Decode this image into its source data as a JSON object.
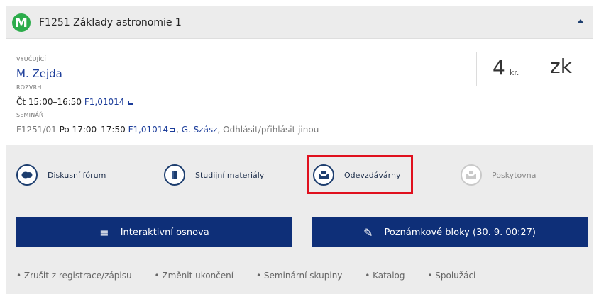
{
  "header": {
    "badge": "M",
    "title": "F1251 Základy astronomie 1"
  },
  "info": {
    "teacher_label": "VYUČUJÍCÍ",
    "teacher": "M. Zejda",
    "schedule_label": "ROZVRH",
    "schedule_time": "Čt 15:00–16:50",
    "schedule_room": "F1,01014",
    "seminar_label": "SEMINÁŘ",
    "seminar_code": "F1251/01",
    "seminar_time": "Po 17:00–17:50",
    "seminar_room": "F1,01014",
    "seminar_teacher": "G. Szász",
    "seminar_action": "Odhlásit/přihlásit jinou",
    "credits": "4",
    "credits_unit": "kr.",
    "completion": "zk"
  },
  "tiles": [
    {
      "label": "Diskusní fórum",
      "icon": "chat-bubbles-icon"
    },
    {
      "label": "Studijní materiály",
      "icon": "folder-icon"
    },
    {
      "label": "Odevzdávárny",
      "icon": "dropbox-icon"
    },
    {
      "label": "Poskytovna",
      "icon": "dropbox-icon"
    }
  ],
  "buttons": {
    "syllabus": "Interaktivní osnova",
    "notes": "Poznámkové bloky (30. 9. 00:27)"
  },
  "footer": [
    "Zrušit z registrace/zápisu",
    "Změnit ukončení",
    "Seminární skupiny",
    "Katalog",
    "Spolužáci"
  ]
}
